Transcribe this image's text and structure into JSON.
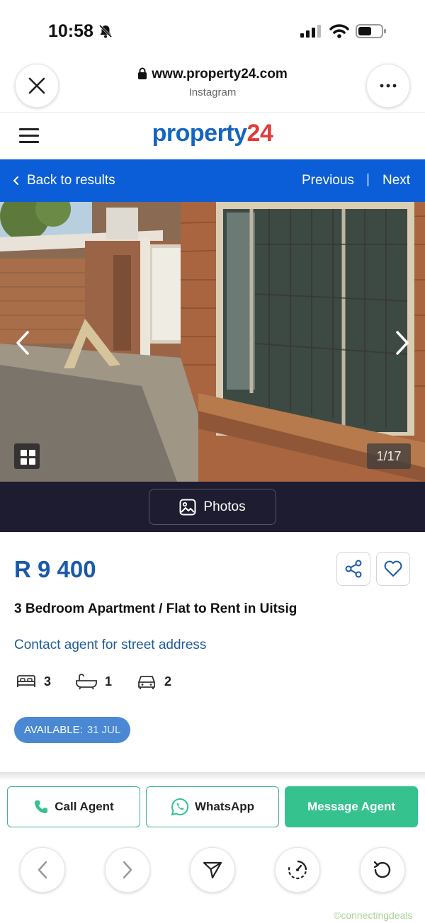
{
  "status_bar": {
    "time": "10:58"
  },
  "browser": {
    "url": "www.property24.com",
    "source": "Instagram"
  },
  "site": {
    "logo_part1": "property",
    "logo_part2": "24"
  },
  "nav": {
    "back_label": "Back to results",
    "previous_label": "Previous",
    "separator": "|",
    "next_label": "Next"
  },
  "gallery": {
    "counter": "1/17",
    "photos_label": "Photos"
  },
  "listing": {
    "price": "R 9 400",
    "title": "3 Bedroom Apartment / Flat to Rent in Uitsig",
    "address": "Contact agent for street address",
    "bedrooms": "3",
    "bathrooms": "1",
    "parking": "2",
    "availability_label": "AVAILABLE:",
    "availability_date": "31 JUL"
  },
  "actions": {
    "call": "Call Agent",
    "whatsapp": "WhatsApp",
    "message": "Message Agent"
  },
  "colors": {
    "brand_blue": "#0b5ed7",
    "brand_red": "#e53935",
    "price_blue": "#1a5aa8",
    "green": "#35c28f",
    "photo_strip": "#1d1c30"
  },
  "watermark": "©connectingdeals"
}
